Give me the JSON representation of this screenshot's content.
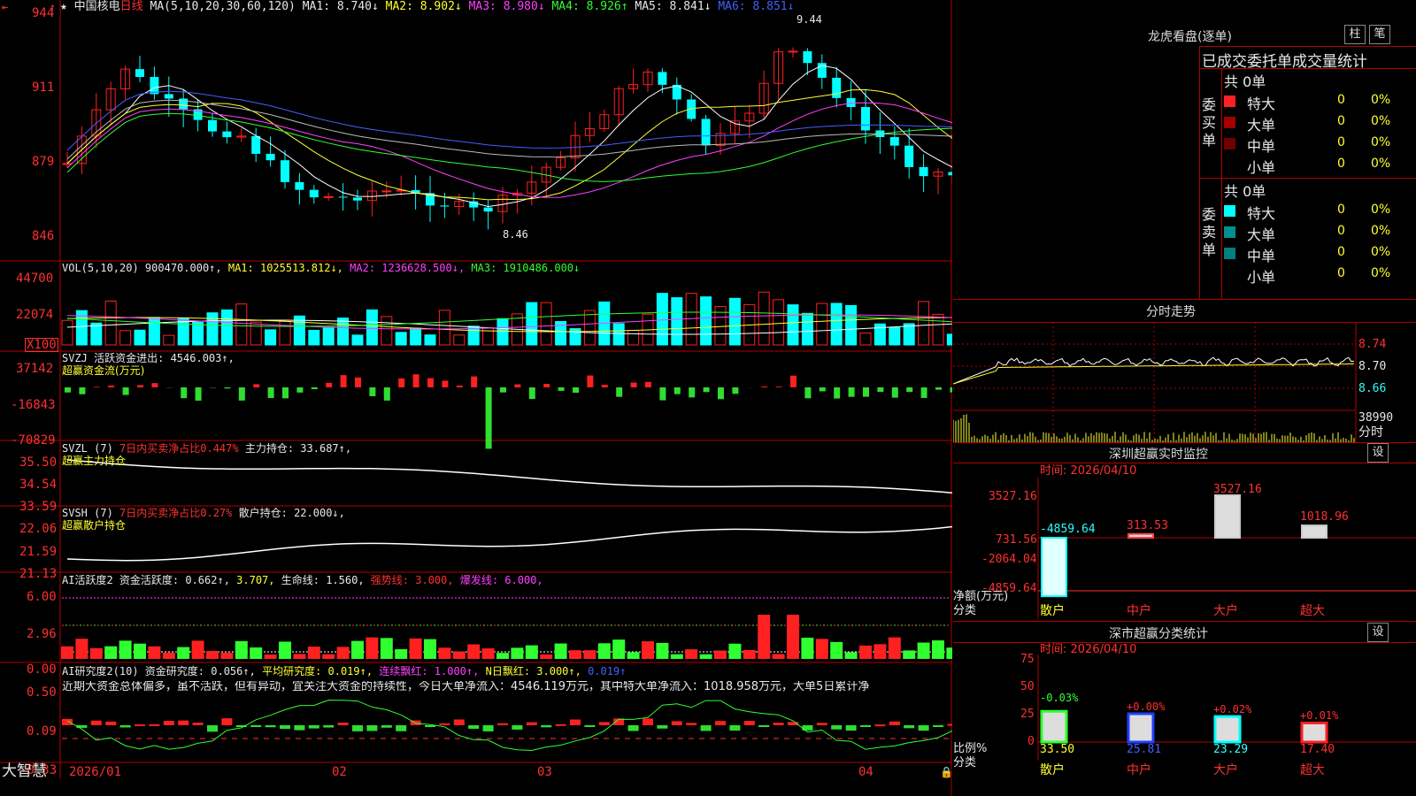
{
  "candle": {
    "stock_name": "中国核电",
    "period": "日线",
    "ma_title": "MA(5,10,20,30,60,120)",
    "ma1": "MA1: 8.740↓",
    "ma2": "MA2: 8.902↓",
    "ma3": "MA3: 8.980↓",
    "ma4": "MA4: 8.926↑",
    "ma5": "MA5: 8.841↓",
    "ma6": "MA6: 8.851↓",
    "y_ticks": [
      "944",
      "911",
      "879",
      "846"
    ],
    "high_label": "9.44",
    "low_label": "8.46"
  },
  "volume": {
    "title": "VOL(5,10,20) 900470.000↑,",
    "ma1": "MA1: 1025513.812↓,",
    "ma2": "MA2: 1236628.500↓,",
    "ma3": "MA3: 1910486.000↓",
    "y_ticks": [
      "44700",
      "22074"
    ],
    "unit": "X100"
  },
  "svzj": {
    "title": "SVZJ  活跃资金进出: 4546.003↑,",
    "subtitle": "超赢资金流(万元)",
    "y_ticks": [
      "37142",
      "-16843",
      "-70829"
    ]
  },
  "svzl": {
    "title": "SVZL (7)",
    "title2": "7日内买卖净占比0.447%",
    "title3": "主力持仓: 33.687↑,",
    "subtitle": "超赢主力持仓",
    "y_ticks": [
      "35.50",
      "34.54",
      "33.59"
    ]
  },
  "svsh": {
    "title": "SVSH (7)",
    "title2": "7日内买卖净占比0.27%",
    "title3": "散户持仓: 22.000↓,",
    "subtitle": "超赢散户持仓",
    "y_ticks": [
      "22.06",
      "21.59",
      "21.13"
    ]
  },
  "ai_active": {
    "title": "AI活跃度2 资金活跃度: 0.662↑,",
    "v2": "3.707,",
    "v3": "生命线: 1.560,",
    "v4": "强势线: 3.000,",
    "v5": "爆发线: 6.000,",
    "y_ticks": [
      "6.00",
      "2.96",
      "0.00"
    ]
  },
  "ai_research": {
    "title": "AI研究度2(10) 资金研究度: 0.056↑,",
    "v2": "平均研究度: 0.019↑,",
    "v3": "连续飘红: 1.000↑,",
    "v4": "N日飘红: 3.000↑,",
    "v5": "0.019↑",
    "comment": "近期大资金总体偏多，虽不活跃，但有异动，宜关注大资金的持续性，今日大单净流入：4546.119万元，其中特大单净流入：1018.958万元，大单5日累计净",
    "y_ticks": [
      "0.50",
      "0.09",
      "-0.33"
    ]
  },
  "x_axis": {
    "logo": "大智慧",
    "labels": [
      "2026/01",
      "02",
      "03",
      "04"
    ]
  },
  "right": {
    "top_title": "龙虎看盘(逐单)",
    "btn_column": "柱",
    "btn_stroke": "笔",
    "order_tabs_title": "已成交委托单成交量统计",
    "buy_label": "委买单",
    "sell_label": "委卖单",
    "buy_total": "共 0单",
    "sell_total": "共 0单",
    "buy_rows": [
      {
        "label": "特大",
        "count": "0",
        "pct": "0%",
        "color": "#ff2020"
      },
      {
        "label": "大单",
        "count": "0",
        "pct": "0%",
        "color": "#a00000"
      },
      {
        "label": "中单",
        "count": "0",
        "pct": "0%",
        "color": "#700000"
      },
      {
        "label": "小单",
        "count": "0",
        "pct": "0%",
        "color": "#000000"
      }
    ],
    "sell_rows": [
      {
        "label": "特大",
        "count": "0",
        "pct": "0%",
        "color": "#00ffff"
      },
      {
        "label": "大单",
        "count": "0",
        "pct": "0%",
        "color": "#009090"
      },
      {
        "label": "中单",
        "count": "0",
        "pct": "0%",
        "color": "#008080"
      },
      {
        "label": "小单",
        "count": "0",
        "pct": "0%",
        "color": "#000000"
      }
    ],
    "intraday_title": "分时走势",
    "intraday_ticks": [
      "8.74",
      "8.70",
      "8.66"
    ],
    "intraday_vol": "38990",
    "intraday_label": "分时",
    "monitor_title": "深圳超赢实时监控",
    "settings": "设",
    "monitor_time": "时间: 2026/04/10",
    "monitor_ticks": [
      "3527.16",
      "731.56",
      "-2064.04",
      "-4859.64"
    ],
    "monitor_axis_label": "净额(万元)",
    "monitor_cat_label": "分类",
    "categories": [
      "散户",
      "中户",
      "大户",
      "超大"
    ],
    "monitor_values": [
      "-4859.64",
      "313.53",
      "3527.16",
      "1018.96"
    ],
    "stats_title": "深市超赢分类统计",
    "stats_time": "时间: 2026/04/10",
    "stats_ticks": [
      "75",
      "50",
      "25",
      "0"
    ],
    "stats_axis_label": "比例%",
    "stats_cat_label": "分类",
    "stats_changes": [
      "-0.03%",
      "+0.00%",
      "+0.02%",
      "+0.01%"
    ],
    "stats_values": [
      "33.50",
      "25.81",
      "23.29",
      "17.40"
    ]
  }
}
